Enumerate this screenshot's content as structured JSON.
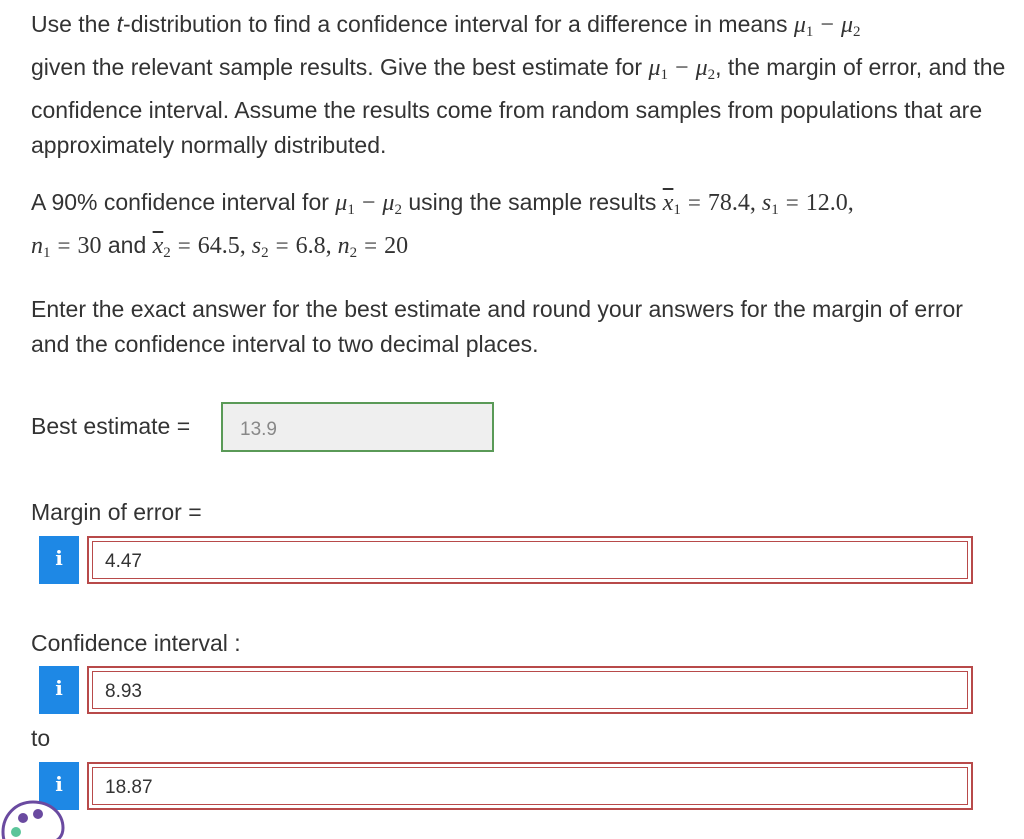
{
  "question": {
    "intro_line1_a": "Use the ",
    "intro_t": "t",
    "intro_line1_b": "-distribution to find a confidence interval for a difference in means ",
    "intro_line2_a": "given the relevant sample results. Give the best estimate for ",
    "intro_line2_b": ", the margin of error, and the confidence interval. Assume the results come from random samples from populations that are approximately normally distributed.",
    "ci_a": "A 90% confidence interval for ",
    "ci_b": " using the sample results ",
    "x1_val": "78.4",
    "s1_val": "12.0",
    "n1_val": "30",
    "and_text": " and ",
    "x2_val": "64.5",
    "s2_val": "6.8",
    "n2_val": "20",
    "instructions": "Enter the exact answer for the best estimate and round your answers for the margin of error and the confidence interval to two decimal places."
  },
  "best_estimate": {
    "label": "Best estimate =",
    "value": "13.9"
  },
  "margin_of_error": {
    "label": "Margin of error =",
    "value": "4.47"
  },
  "confidence_interval": {
    "label": "Confidence interval :",
    "lower": "8.93",
    "to_label": "to",
    "upper": "18.87"
  },
  "info_icon": "i",
  "colors": {
    "accent_blue": "#1e88e5",
    "correct_green": "#5a9a57",
    "incorrect_red": "#b84a4a",
    "text": "#333333"
  }
}
